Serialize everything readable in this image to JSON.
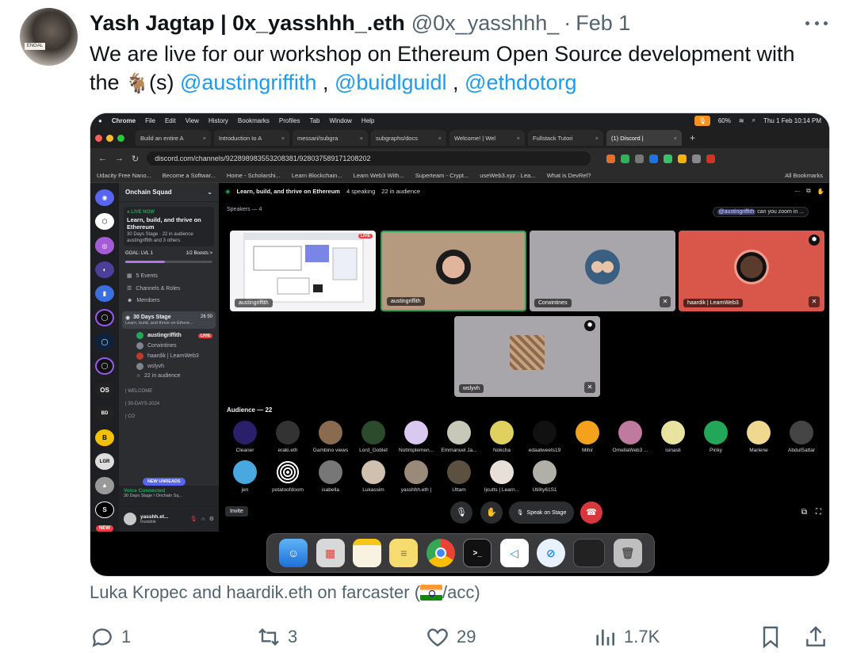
{
  "tweet": {
    "author_name": "Yash Jagtap | 0x_yasshhh_.eth",
    "handle": "@0x_yasshhh_",
    "separator": "·",
    "date": "Feb 1",
    "text_start": "We are live for our workshop on Ethereum Open Source development with",
    "text_the": "the",
    "goat_emoji": "🐐",
    "text_s": "(s)",
    "mention_1": "@austingriffith",
    "mention_2": "@buidlguidl",
    "mention_3": "@ethdotorg",
    "comma": ",",
    "caption_start": "Luka Kropec and haardik.eth on farcaster (",
    "caption_end": "/acc)",
    "replies": "1",
    "retweets": "3",
    "likes": "29",
    "views": "1.7K"
  },
  "mac_menu": {
    "app": "Chrome",
    "items": [
      "File",
      "Edit",
      "View",
      "History",
      "Bookmarks",
      "Profiles",
      "Tab",
      "Window",
      "Help"
    ],
    "battery": "60%",
    "clock": "Thu 1 Feb 10:14 PM"
  },
  "browser": {
    "tabs": [
      "Build an entire A",
      "Introduction to A",
      "messari/subgra",
      "subgraphs/docs",
      "Welcome! | Wel",
      "Fullstack Tutori",
      "(1) Discord |"
    ],
    "url": "discord.com/channels/922898983553208381/928037589171208202",
    "bookmarks": [
      "Udacity Free Nano...",
      "Become a Softwar...",
      "Home - Scholarshi...",
      "Learn Blockchain...",
      "Learn Web3 With...",
      "Superteam - Crypt...",
      "useWeb3.xyz · Lea...",
      "What is DevRel?"
    ],
    "all_bookmarks": "All Bookmarks"
  },
  "discord": {
    "server_name": "Onchain Squad",
    "live_now": "● LIVE NOW",
    "live_title": "Learn, build, and thrive on Ethereum",
    "live_meta": "30 Days Stage · 22 in audience",
    "live_others": "austingriffith and 3 others",
    "goal_label": "GOAL: LVL 1",
    "goal_boosts": "1/2 Boosts >",
    "events": "5 Events",
    "channels_roles": "Channels & Roles",
    "members": "Members",
    "stage_channel": "30 Days Stage",
    "stage_counts": "26 50",
    "stage_sub": "Learn, build, and thrive on Ethere...",
    "stage_members": [
      "austingriffith",
      "Corwintines",
      "haardik | LearnWeb3",
      "wslyvh"
    ],
    "live_badge": "LIVE",
    "in_audience": "22 in audience",
    "cat_welcome": "| WELCOME",
    "cat_30days": "| 30-DAYS-2024",
    "cat_co": "| CO",
    "new_unreads": "NEW UNREADS",
    "voice_connected": "Voice Connected",
    "voice_sub": "30 Days Stage / Onchain Sq...",
    "user_name": "yasshh.et...",
    "user_status": "Invisible",
    "rail_new": "NEW",
    "stage_header": "Learn, build, and thrive on Ethereum",
    "speaking": "4 speaking",
    "audience_count_top": "22 in audience",
    "speakers_label": "Speakers — 4",
    "tooltip_mention": "@austingriffith",
    "tooltip_text": "can you zoom in ...",
    "tiles": [
      "austingriffith",
      "austingriffith",
      "Corwintines",
      "haardik | LearnWeb3",
      "wslyvh"
    ],
    "tile_live": "LIVE",
    "audience_label": "Audience — 22",
    "audience_row1": [
      "Cleaner",
      "eraki.eth",
      "Gambino views",
      "Lord_Goblet",
      "NotImplemen...",
      "Emmanuel Ja...",
      "Nokcha",
      "edaatweets19",
      "Mihir",
      "OrnellaWeb3 ...",
      "isinasli",
      "Pinky",
      "Marlene",
      "AbdulSattar"
    ],
    "audience_row2": [
      "jen",
      "potatoofdoom",
      "isabella",
      "Lukassim",
      "yasshhh.eth |",
      "Uttam",
      "ljcutts | Learn...",
      "Utility61S1"
    ],
    "speak_on_stage": "Speak on Stage",
    "invite": "Invite"
  },
  "colors": {
    "link": "#1d9bf0",
    "muted_text": "#536471",
    "discord_bg": "#000000",
    "discord_green": "#23a55a",
    "discord_red": "#f23f43",
    "tile_tan": "#b59a7f",
    "tile_grey": "#a9a6ab",
    "tile_red": "#d9574a"
  }
}
